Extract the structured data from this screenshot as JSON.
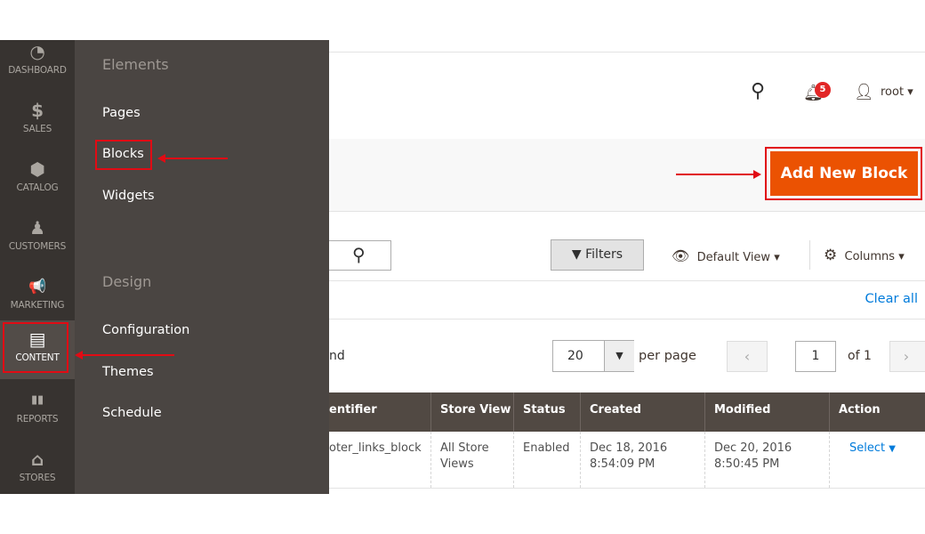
{
  "nav": [
    {
      "label": "DASHBOARD",
      "icon": "dashboard-icon",
      "glyph": "◔"
    },
    {
      "label": "SALES",
      "icon": "dollar-icon",
      "glyph": "$"
    },
    {
      "label": "CATALOG",
      "icon": "box-icon",
      "glyph": "⬢"
    },
    {
      "label": "CUSTOMERS",
      "icon": "person-icon",
      "glyph": "♟"
    },
    {
      "label": "MARKETING",
      "icon": "megaphone-icon",
      "glyph": "📢"
    },
    {
      "label": "CONTENT",
      "icon": "layout-icon",
      "glyph": "▤"
    },
    {
      "label": "REPORTS",
      "icon": "bar-chart-icon",
      "glyph": "▮▮"
    },
    {
      "label": "STORES",
      "icon": "store-icon",
      "glyph": "⌂"
    }
  ],
  "flyout": {
    "elements_title": "Elements",
    "pages": "Pages",
    "blocks": "Blocks",
    "widgets": "Widgets",
    "design_title": "Design",
    "configuration": "Configuration",
    "themes": "Themes",
    "schedule": "Schedule"
  },
  "header": {
    "notifications_count": "5",
    "user": "root"
  },
  "actions": {
    "add_new_block": "Add New Block"
  },
  "toolbar": {
    "filters": "Filters",
    "default_view": "Default View",
    "columns": "Columns",
    "clear_all": "Clear all"
  },
  "pager": {
    "records_partial": "nd",
    "per_page_value": "20",
    "per_page_label": "per page",
    "page": "1",
    "of": "of 1"
  },
  "table": {
    "headers": [
      "entifier",
      "Store View",
      "Status",
      "Created",
      "Modified",
      "Action"
    ],
    "rows": [
      [
        "oter_links_block",
        "All Store Views",
        "Enabled",
        "Dec 18, 2016 8:54:09 PM",
        "Dec 20, 2016 8:50:45 PM",
        "Select"
      ]
    ]
  },
  "colors": {
    "accent": "#eb5202",
    "annotation": "#e10b14",
    "link": "#007bdb",
    "nav_bg": "#373330"
  }
}
